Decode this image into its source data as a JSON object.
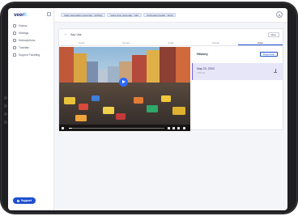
{
  "sidebar": {
    "logo": "veer",
    "logo_mark": "ll",
    "items": [
      {
        "label": "Videos",
        "icon": "video-icon"
      },
      {
        "label": "Settings",
        "icon": "gear-icon"
      },
      {
        "label": "Subscriptions",
        "icon": "card-icon"
      },
      {
        "label": "Tutorials",
        "icon": "book-icon"
      },
      {
        "label": "Support Ticketing",
        "icon": "ticket-icon"
      }
    ],
    "support_label": "Support"
  },
  "topbar": {
    "chips": [
      "Video Generation (seconds) : 1/infinity",
      "Voice-Over (seconds) : 1/10",
      "AI Preview Credits : 10/10"
    ],
    "avatar_initial": "A"
  },
  "card": {
    "title": "Sao Vidr",
    "more_label": "More",
    "tabs": [
      "Script",
      "Scenes",
      "Audio",
      "Visuals",
      "Video"
    ],
    "active_tab": "Video"
  },
  "video": {
    "progress": 0.03
  },
  "history": {
    "title": "History",
    "regenerate_label": "Regenerate",
    "items": [
      {
        "date": "May 20, 2024",
        "sub": "1:54 min"
      }
    ]
  },
  "colors": {
    "accent": "#1f4fd1",
    "history_highlight": "#e7e6f8",
    "logo_navy": "#1a2f7a"
  }
}
